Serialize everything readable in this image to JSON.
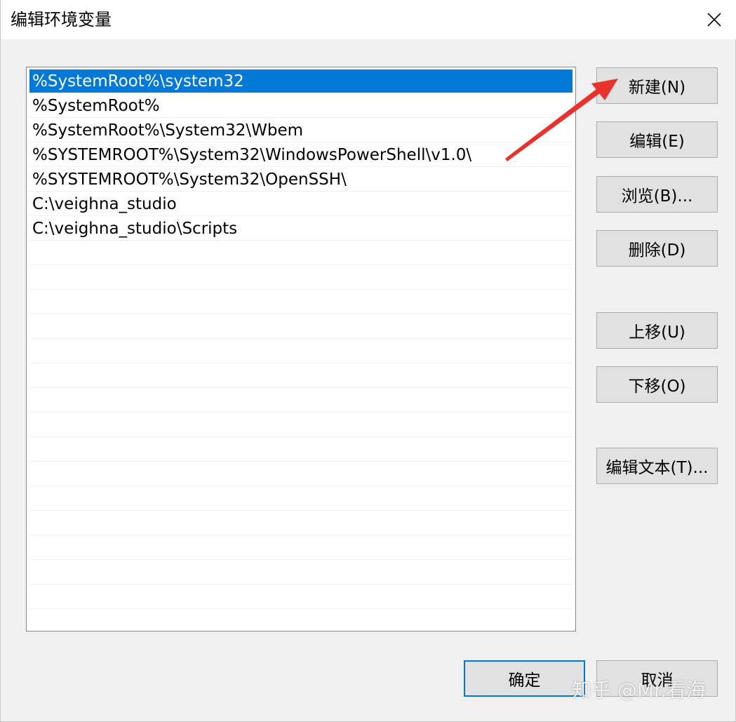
{
  "window": {
    "title": "编辑环境变量",
    "close_icon": "close-icon"
  },
  "path_list": {
    "selected_index": 0,
    "items": [
      "%SystemRoot%\\system32",
      "%SystemRoot%",
      "%SystemRoot%\\System32\\Wbem",
      "%SYSTEMROOT%\\System32\\WindowsPowerShell\\v1.0\\",
      "%SYSTEMROOT%\\System32\\OpenSSH\\",
      "C:\\veighna_studio",
      "C:\\veighna_studio\\Scripts"
    ],
    "empty_rows": 16
  },
  "buttons": {
    "new": "新建(N)",
    "edit": "编辑(E)",
    "browse": "浏览(B)...",
    "delete": "删除(D)",
    "move_up": "上移(U)",
    "move_down": "下移(O)",
    "edit_text": "编辑文本(T)...",
    "ok": "确定",
    "cancel": "取消"
  },
  "watermark": "知乎 @Mr.看海",
  "colors": {
    "selection": "#0078d7",
    "annotation_arrow": "#e8322b"
  }
}
